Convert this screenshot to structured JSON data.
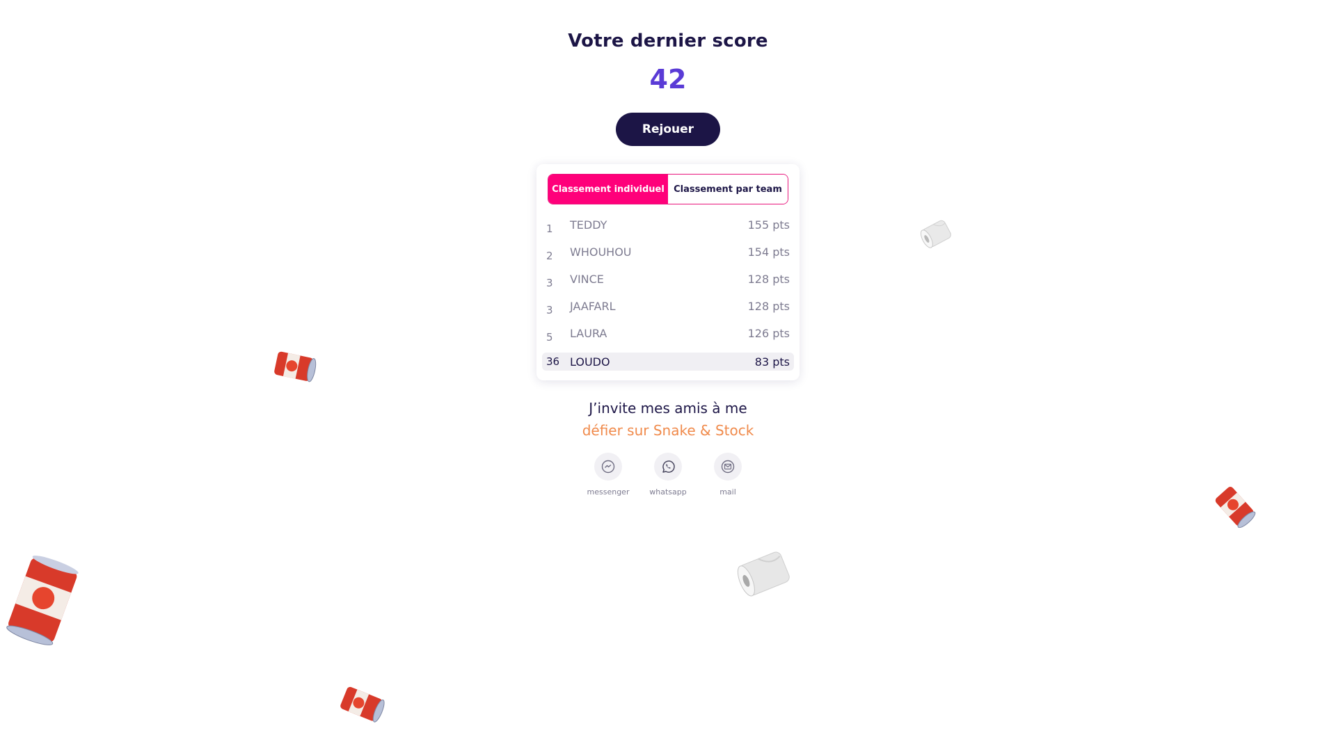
{
  "header": {
    "title": "Votre dernier score",
    "score": "42",
    "replay_label": "Rejouer"
  },
  "leaderboard": {
    "tabs": [
      {
        "label": "Classement individuel",
        "active": true
      },
      {
        "label": "Classement par team",
        "active": false
      }
    ],
    "rows": [
      {
        "rank": "1",
        "name": "TEDDY",
        "points": "155 pts"
      },
      {
        "rank": "2",
        "name": "WHOUHOU",
        "points": "154 pts"
      },
      {
        "rank": "3",
        "name": "VINCE",
        "points": "128 pts"
      },
      {
        "rank": "3",
        "name": "JAAFARL",
        "points": "128 pts"
      },
      {
        "rank": "5",
        "name": "LAURA",
        "points": "126 pts"
      }
    ],
    "current_player": {
      "rank": "36",
      "name": "LOUDO",
      "points": "83 pts"
    }
  },
  "invite": {
    "line1": "J’invite mes amis à me",
    "line2": "défier sur Snake & Stock"
  },
  "share": [
    {
      "label": "messenger",
      "icon": "messenger-icon"
    },
    {
      "label": "whatsapp",
      "icon": "whatsapp-icon"
    },
    {
      "label": "mail",
      "icon": "mail-icon"
    }
  ],
  "colors": {
    "navy": "#1c1546",
    "score_purple": "#5a3bd6",
    "tab_pink": "#ff007a",
    "invite_orange": "#f08a4b",
    "muted_text": "#7d7b90"
  },
  "decorations": [
    "tomato-can-icon",
    "toilet-paper-roll-icon"
  ]
}
